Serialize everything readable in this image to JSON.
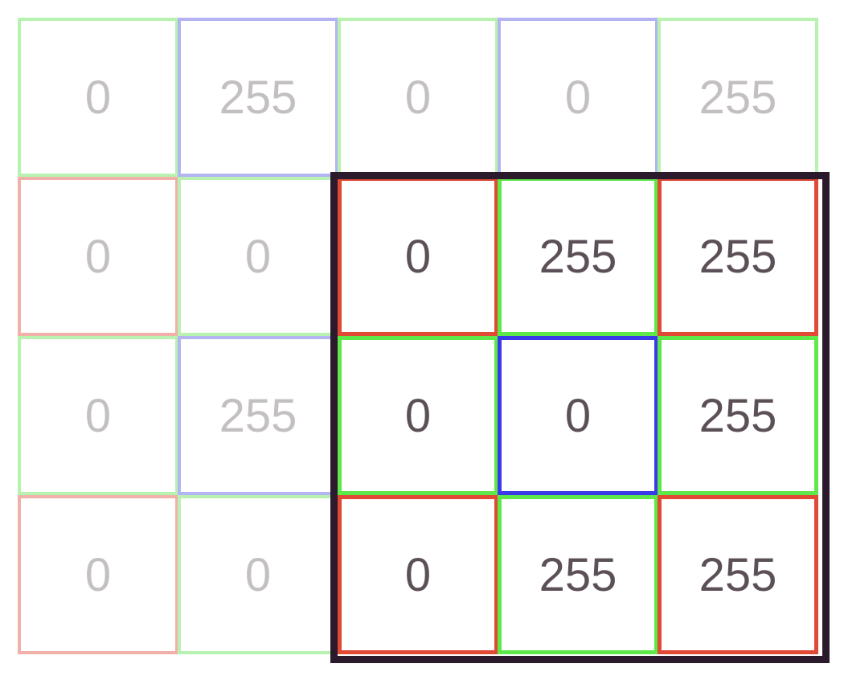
{
  "colors": {
    "red": "#e04a34",
    "green": "#5ee84a",
    "blue": "#3a3ae8",
    "faded_red": "#f2b0aa",
    "faded_green": "#b8f2b0",
    "faded_blue": "#b4b4f2",
    "window": "#2a1a2c",
    "faded_text": "#c4c0c1",
    "active_text": "#5c5058"
  },
  "grid": {
    "rows": [
      [
        {
          "value": "0",
          "channel": "green",
          "state": "faded"
        },
        {
          "value": "255",
          "channel": "blue",
          "state": "faded"
        },
        {
          "value": "0",
          "channel": "green",
          "state": "faded"
        },
        {
          "value": "0",
          "channel": "blue",
          "state": "faded"
        },
        {
          "value": "255",
          "channel": "green",
          "state": "faded"
        }
      ],
      [
        {
          "value": "0",
          "channel": "red",
          "state": "faded"
        },
        {
          "value": "0",
          "channel": "green",
          "state": "faded"
        },
        {
          "value": "0",
          "channel": "red",
          "state": "active"
        },
        {
          "value": "255",
          "channel": "green",
          "state": "active"
        },
        {
          "value": "255",
          "channel": "red",
          "state": "active"
        }
      ],
      [
        {
          "value": "0",
          "channel": "green",
          "state": "faded"
        },
        {
          "value": "255",
          "channel": "blue",
          "state": "faded"
        },
        {
          "value": "0",
          "channel": "green",
          "state": "active"
        },
        {
          "value": "0",
          "channel": "blue",
          "state": "center"
        },
        {
          "value": "255",
          "channel": "green",
          "state": "active"
        }
      ],
      [
        {
          "value": "0",
          "channel": "red",
          "state": "faded"
        },
        {
          "value": "0",
          "channel": "green",
          "state": "faded"
        },
        {
          "value": "0",
          "channel": "red",
          "state": "active"
        },
        {
          "value": "255",
          "channel": "green",
          "state": "active"
        },
        {
          "value": "255",
          "channel": "red",
          "state": "active"
        }
      ]
    ]
  }
}
